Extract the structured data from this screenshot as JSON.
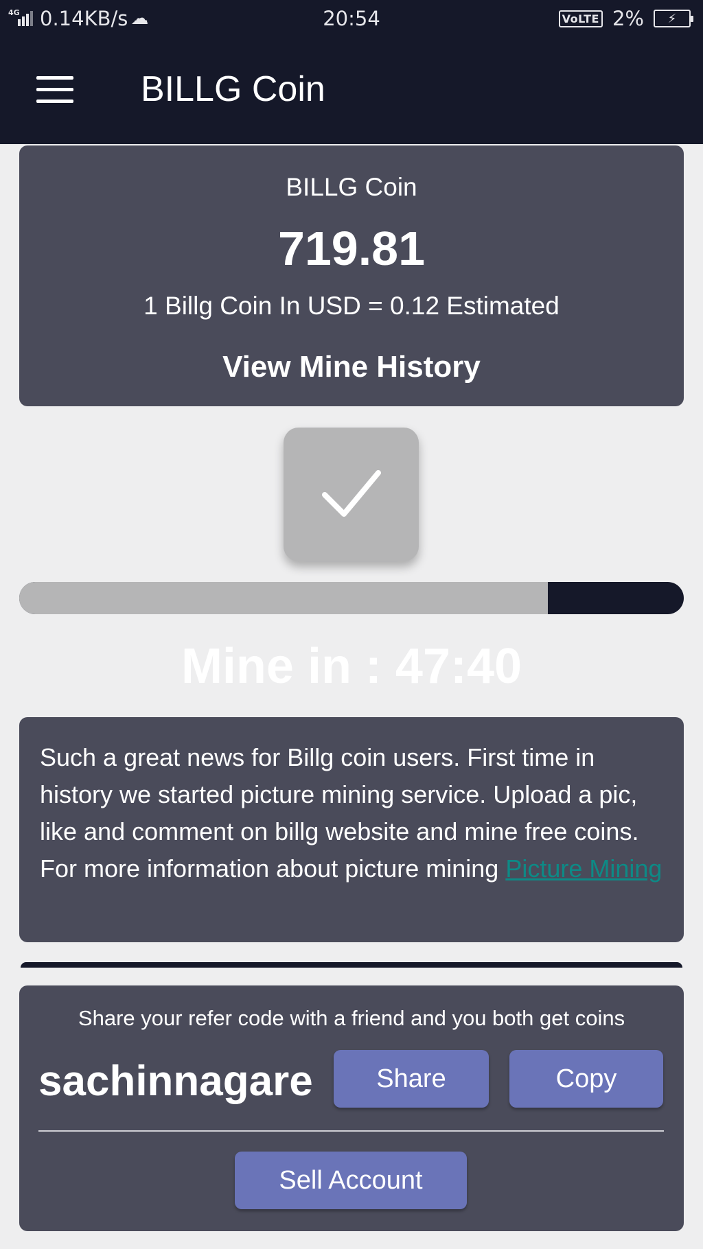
{
  "status_bar": {
    "network_type": "4G",
    "speed": "0.14KB/s",
    "time": "20:54",
    "volte": "VoLTE",
    "battery": "2%"
  },
  "app_bar": {
    "title": "BILLG Coin",
    "menu_icon": "hamburger-menu-icon"
  },
  "balance_card": {
    "coin_name": "BILLG Coin",
    "balance": "719.81",
    "rate": "1 Billg Coin In USD = 0.12 Estimated",
    "history_link": "View Mine History"
  },
  "mine": {
    "button_icon": "checkmark-icon",
    "progress_fraction": 0.795,
    "timer_text": "Mine in : 47:40"
  },
  "news": {
    "text": "Such a great news for Billg coin users. First time in history we started picture mining service. Upload a pic, like and comment on billg website and mine free coins. For more information about picture mining ",
    "link_label": "Picture Mining"
  },
  "refer": {
    "text": "Share your refer code with a friend and you both get coins",
    "code": "sachinnagare",
    "share_label": "Share",
    "copy_label": "Copy",
    "sell_label": "Sell Account"
  },
  "colors": {
    "app_bar": "#151829",
    "card": "#4a4b5a",
    "button": "#6a74b8",
    "link": "#0d8a86",
    "background": "#eeeeef"
  }
}
